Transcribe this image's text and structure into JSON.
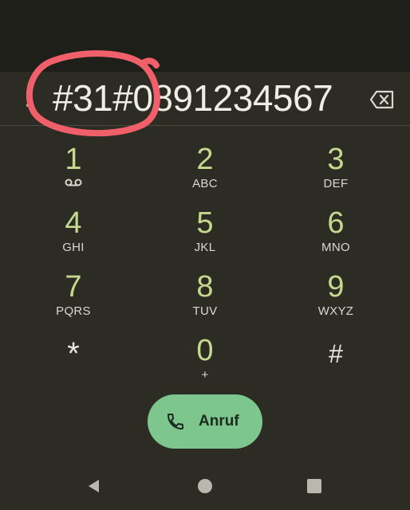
{
  "dialer": {
    "number": "#31#0891234567"
  },
  "keypad": {
    "keys": [
      {
        "digit": "1",
        "letters": "",
        "icon": "voicemail-icon"
      },
      {
        "digit": "2",
        "letters": "ABC"
      },
      {
        "digit": "3",
        "letters": "DEF"
      },
      {
        "digit": "4",
        "letters": "GHI"
      },
      {
        "digit": "5",
        "letters": "JKL"
      },
      {
        "digit": "6",
        "letters": "MNO"
      },
      {
        "digit": "7",
        "letters": "PQRS"
      },
      {
        "digit": "8",
        "letters": "TUV"
      },
      {
        "digit": "9",
        "letters": "WXYZ"
      },
      {
        "digit": "*",
        "letters": ""
      },
      {
        "digit": "0",
        "letters": "+"
      },
      {
        "digit": "#",
        "letters": ""
      }
    ]
  },
  "call": {
    "label": "Anruf",
    "icon": "phone-icon"
  },
  "nav": {
    "back_icon": "back-triangle-icon",
    "home_icon": "home-circle-icon",
    "recents_icon": "recents-square-icon"
  },
  "colors": {
    "background": "#2c2c24",
    "status_area": "#1f1f1a",
    "digit": "#c5d98e",
    "letters": "#d8d8cc",
    "number_text": "#eeeee4",
    "call_button": "#7dc68d",
    "annotation_circle": "#f0606a"
  }
}
